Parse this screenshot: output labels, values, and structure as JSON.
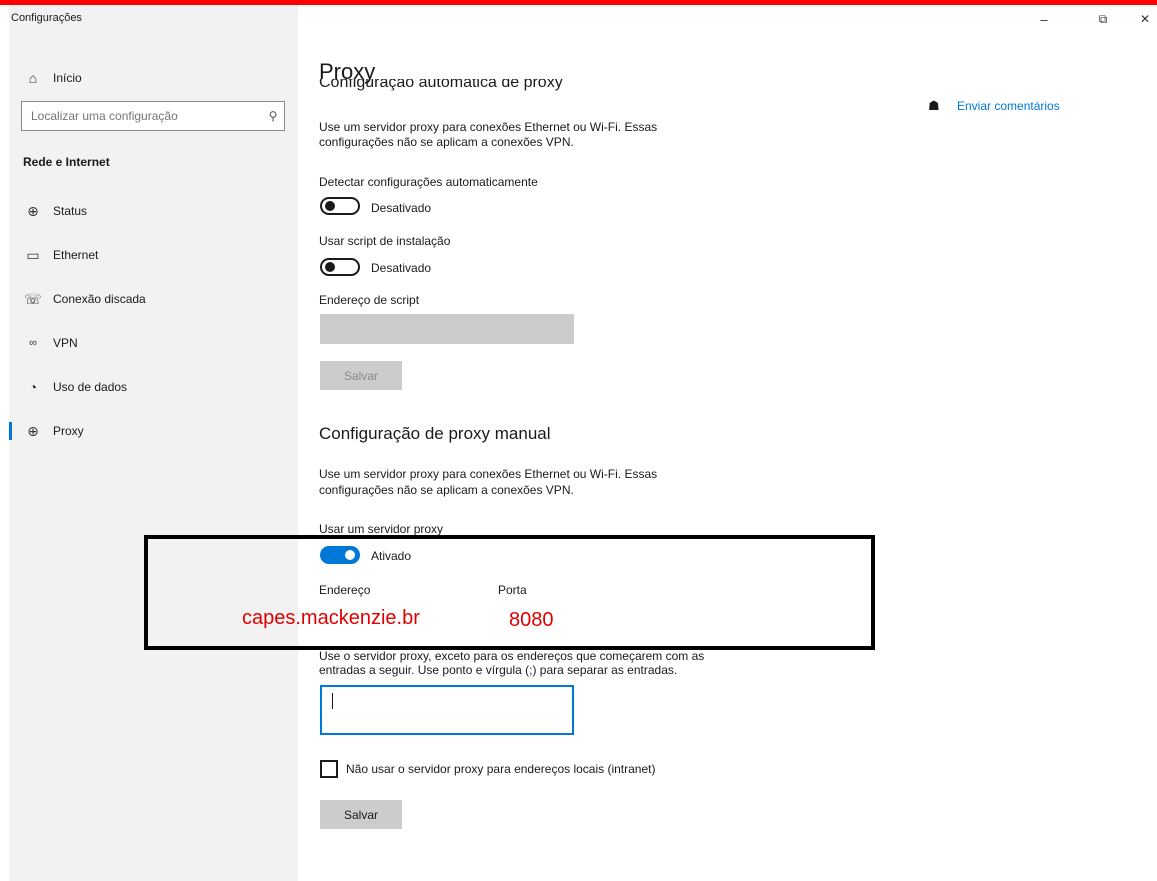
{
  "window": {
    "title": "Configurações",
    "minimize_glyph": "–",
    "maximize_glyph": "⧉",
    "close_glyph": "✕"
  },
  "colors": {
    "top_bar": "#ff0000",
    "accent": "#0078d7",
    "annotation_text": "#e00000",
    "annotation_box": "#000000"
  },
  "sidebar": {
    "home": {
      "label": "Início",
      "icon": "home-icon"
    },
    "search": {
      "placeholder": "Localizar uma configuração",
      "icon": "search-icon"
    },
    "section_title": "Rede e Internet",
    "items": [
      {
        "label": "Status",
        "icon": "globe-status-icon",
        "active": false
      },
      {
        "label": "Ethernet",
        "icon": "ethernet-icon",
        "active": false
      },
      {
        "label": "Conexão discada",
        "icon": "dialup-icon",
        "active": false
      },
      {
        "label": "VPN",
        "icon": "vpn-icon",
        "active": false
      },
      {
        "label": "Uso de dados",
        "icon": "data-usage-icon",
        "active": false
      },
      {
        "label": "Proxy",
        "icon": "globe-icon",
        "active": true
      }
    ]
  },
  "main": {
    "page_title": "Proxy",
    "cut_heading": "Configuração automática de proxy",
    "feedback": {
      "label": "Enviar comentários",
      "icon": "feedback-icon"
    },
    "auto": {
      "description_line1": "Use um servidor proxy para conexões Ethernet ou Wi-Fi. Essas",
      "description_line2": "configurações não se aplicam a conexões VPN.",
      "detect_label": "Detectar configurações automaticamente",
      "detect_state": "Desativado",
      "script_label": "Usar script de instalação",
      "script_state": "Desativado",
      "script_address_label": "Endereço de script",
      "save_label": "Salvar"
    },
    "manual": {
      "heading": "Configuração de proxy manual",
      "description_line1": "Use um servidor proxy para conexões Ethernet ou Wi-Fi. Essas",
      "description_line2": "configurações não se aplicam a conexões VPN.",
      "use_proxy_label": "Usar um servidor proxy",
      "use_proxy_state": "Ativado",
      "address_label": "Endereço",
      "port_label": "Porta",
      "address_value": "capes.mackenzie.br",
      "port_value": "8080",
      "exceptions_line1": "Use o servidor proxy, exceto para os endereços que começarem com as",
      "exceptions_line2": "entradas a seguir. Use ponto e vírgula (;) para separar as entradas.",
      "exceptions_value": "",
      "local_checkbox_label": "Não usar o servidor proxy para endereços locais (intranet)",
      "local_checked": false,
      "save_label": "Salvar"
    }
  }
}
